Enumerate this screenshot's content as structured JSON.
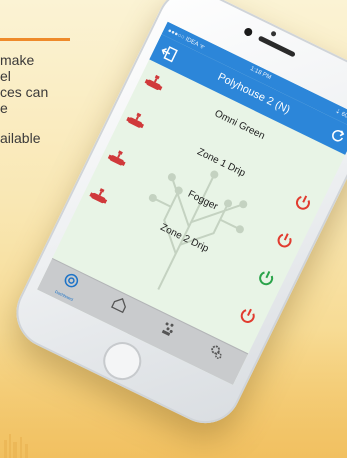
{
  "promo": {
    "lines": [
      "make",
      "el",
      "ces can",
      "e",
      "",
      "ailable"
    ]
  },
  "app": {
    "status": {
      "carrier": "●●●○○ IDEA ᯤ",
      "time": "1:18 PM",
      "battery": "⇣ 60% ■"
    },
    "title": "Polyhouse 2 (N)",
    "devices": [
      {
        "name": "Omni Green",
        "power_state": "off",
        "power_color": "#e13b2f",
        "show_power": false
      },
      {
        "name": "Zone 1 Drip",
        "power_state": "off",
        "power_color": "#e13b2f",
        "show_power": true
      },
      {
        "name": "Fogger",
        "power_state": "off",
        "power_color": "#e13b2f",
        "show_power": true
      },
      {
        "name": "Zone 2 Drip",
        "power_state": "on",
        "power_color": "#2aa34a",
        "show_power": true
      }
    ],
    "extra_power_color": "#e13b2f",
    "tabs": [
      {
        "label": "Dashboard",
        "icon": "dashboard-icon",
        "active": true
      },
      {
        "label": "",
        "icon": "home-icon",
        "active": false
      },
      {
        "label": "",
        "icon": "plant-icon",
        "active": false
      },
      {
        "label": "",
        "icon": "gears-icon",
        "active": false
      }
    ],
    "colors": {
      "navbar": "#2c86d9",
      "valve": "#d0393b",
      "active_tab": "#1d73c7"
    }
  }
}
